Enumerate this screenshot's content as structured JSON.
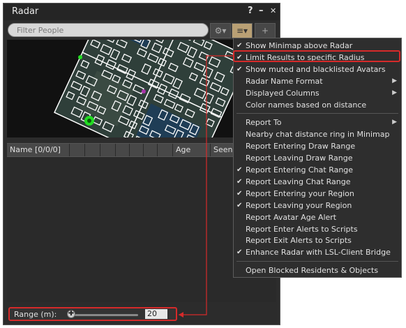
{
  "window": {
    "title": "Radar",
    "help_label": "?",
    "minimize_label": "–",
    "close_label": "✕"
  },
  "toolbar": {
    "search_placeholder": "Filter People",
    "gear_glyph": "⚙▾",
    "options_glyph": "≡▾",
    "add_glyph": "+"
  },
  "table": {
    "columns": [
      "Name [0/0/0]",
      "",
      "",
      "",
      "",
      "",
      "",
      "",
      "Age",
      "Seen"
    ]
  },
  "range": {
    "label": "Range (m):",
    "value": "20",
    "slider_icon": "✚"
  },
  "menu": {
    "groups": [
      [
        {
          "label": "Show Minimap above Radar",
          "checked": true,
          "submenu": false
        },
        {
          "label": "Limit Results to specific Radius",
          "checked": true,
          "submenu": false
        },
        {
          "label": "Show muted and blacklisted Avatars",
          "checked": true,
          "submenu": false
        },
        {
          "label": "Radar Name Format",
          "checked": false,
          "submenu": true
        },
        {
          "label": "Displayed Columns",
          "checked": false,
          "submenu": true
        },
        {
          "label": "Color names based on distance",
          "checked": false,
          "submenu": false
        }
      ],
      [
        {
          "label": "Report To",
          "checked": false,
          "submenu": true
        },
        {
          "label": "Nearby chat distance ring in Minimap",
          "checked": false,
          "submenu": false
        },
        {
          "label": "Report Entering Draw Range",
          "checked": false,
          "submenu": false
        },
        {
          "label": "Report Leaving Draw Range",
          "checked": false,
          "submenu": false
        },
        {
          "label": "Report Entering Chat Range",
          "checked": true,
          "submenu": false
        },
        {
          "label": "Report Leaving Chat Range",
          "checked": true,
          "submenu": false
        },
        {
          "label": "Report Entering your Region",
          "checked": true,
          "submenu": false
        },
        {
          "label": "Report Leaving your Region",
          "checked": true,
          "submenu": false
        },
        {
          "label": "Report Avatar Age Alert",
          "checked": false,
          "submenu": false
        },
        {
          "label": "Report Enter Alerts to Scripts",
          "checked": false,
          "submenu": false
        },
        {
          "label": "Report Exit Alerts to Scripts",
          "checked": false,
          "submenu": false
        },
        {
          "label": "Enhance Radar with LSL-Client Bridge",
          "checked": true,
          "submenu": false
        }
      ],
      [
        {
          "label": "Open Blocked Residents & Objects",
          "checked": false,
          "submenu": false
        }
      ]
    ],
    "check_glyph": "✔",
    "submenu_glyph": "▶"
  },
  "colors": {
    "highlight": "#d62a2a",
    "accent": "#b9a074"
  }
}
